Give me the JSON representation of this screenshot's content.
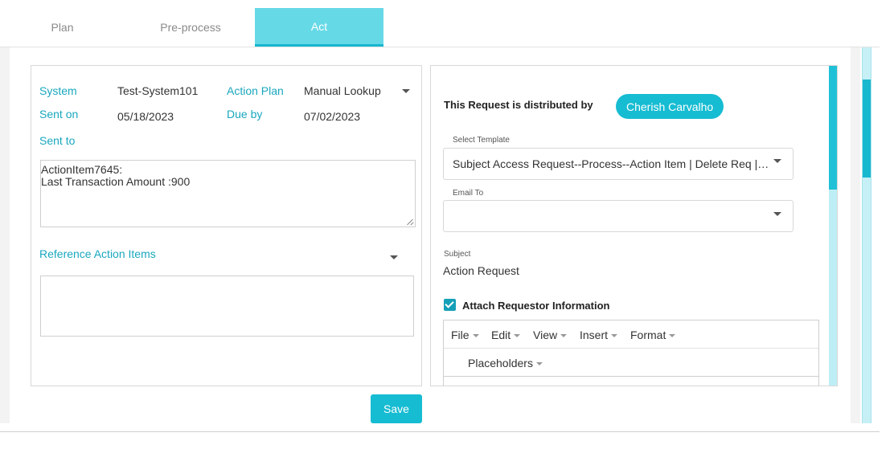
{
  "tabs": [
    {
      "label": "Plan",
      "active": false
    },
    {
      "label": "Pre-process",
      "active": false
    },
    {
      "label": "Act",
      "active": true
    }
  ],
  "left": {
    "system_label": "System",
    "system_value": "Test-System101",
    "action_plan_label": "Action Plan",
    "action_plan_value": "Manual Lookup",
    "sent_on_label": "Sent on",
    "sent_on_value": "05/18/2023",
    "due_by_label": "Due by",
    "due_by_value": "07/02/2023",
    "sent_to_label": "Sent to",
    "notes_line1": "ActionItem7645:",
    "notes_line2": "Last Transaction Amount :900",
    "reference_label": "Reference Action Items"
  },
  "save_label": "Save",
  "right": {
    "distributed_text": "This Request is distributed by",
    "distributor_name": "Cherish Carvalho",
    "template_label": "Select Template",
    "template_value": "Subject Access Request--Process--Action Item | Delete Req | Subject Access Request--Process--Action Item",
    "email_label": "Email To",
    "subject_label": "Subject",
    "subject_value": "Action Request",
    "attach_label": "Attach Requestor Information",
    "attach_checked": true,
    "menus": [
      "File",
      "Edit",
      "View",
      "Insert",
      "Format"
    ],
    "placeholders_label": "Placeholders"
  },
  "colors": {
    "accent": "#16bcd2",
    "active_tab": "#66d9e6",
    "label_teal": "#19a7be"
  }
}
